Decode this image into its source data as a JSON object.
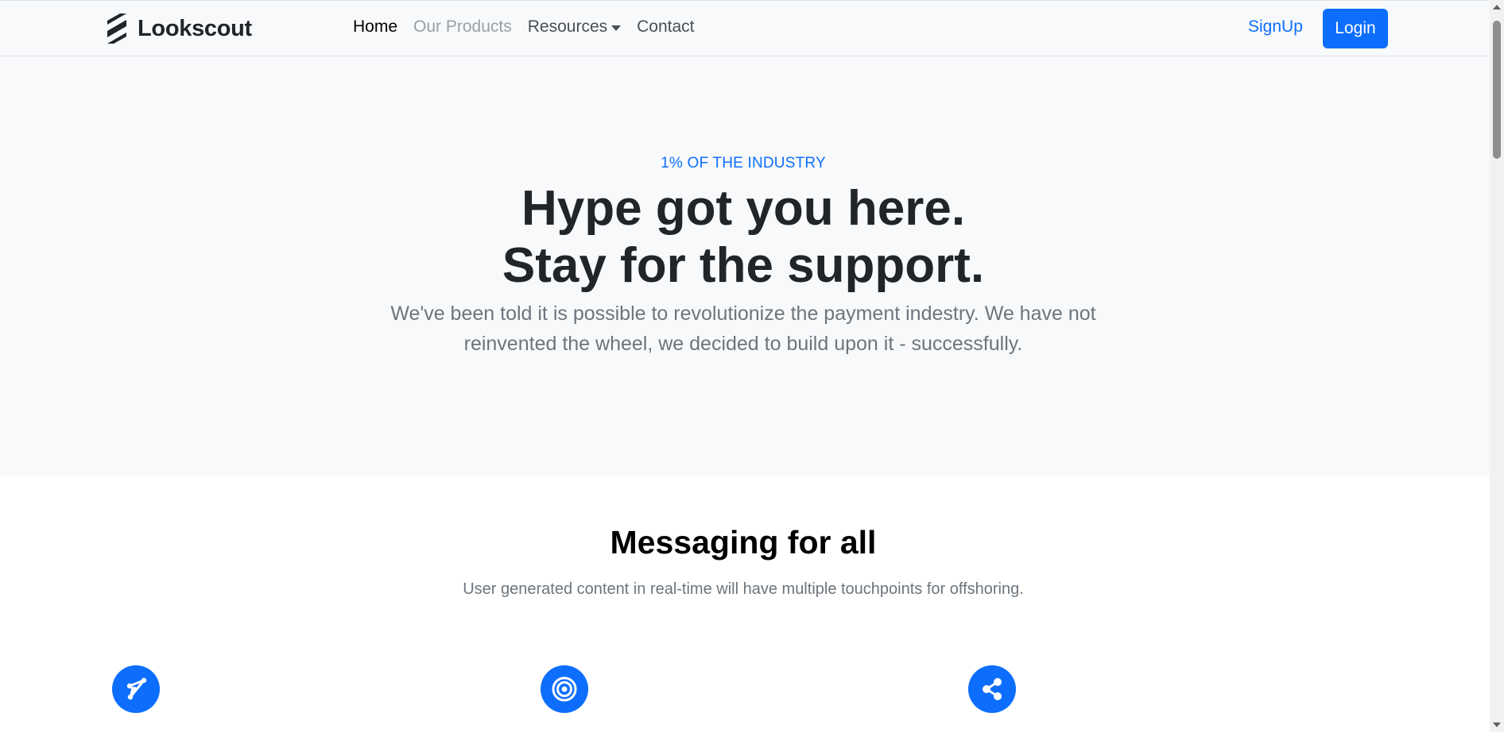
{
  "navbar": {
    "brand_name": "Lookscout",
    "brand_icon": "stacked-stripes-logo",
    "links": [
      {
        "label": "Home",
        "state": "active"
      },
      {
        "label": "Our Products",
        "state": "disabled"
      },
      {
        "label": "Resources",
        "state": "dropdown"
      },
      {
        "label": "Contact",
        "state": "default"
      }
    ],
    "signup_label": "SignUp",
    "login_label": "Login"
  },
  "hero": {
    "eyebrow": "1% OF THE INDUSTRY",
    "title_line1": "Hype got you here.",
    "title_line2": "Stay for the support.",
    "subtitle": "We've been told it is possible to revolutionize the payment indestry. We have not reinvented the wheel, we decided to build upon it - successfully."
  },
  "features": {
    "title": "Messaging for all",
    "subtitle": "User generated content in real-time will have multiple touchpoints for offshoring.",
    "icons": [
      "send-icon",
      "target-icon",
      "share-icon"
    ]
  },
  "colors": {
    "accent": "#0d6efd",
    "hero_background": "#f8f9fa",
    "heading": "#212529",
    "muted": "#6c757d",
    "disabled_link": "#9aa0a6"
  }
}
